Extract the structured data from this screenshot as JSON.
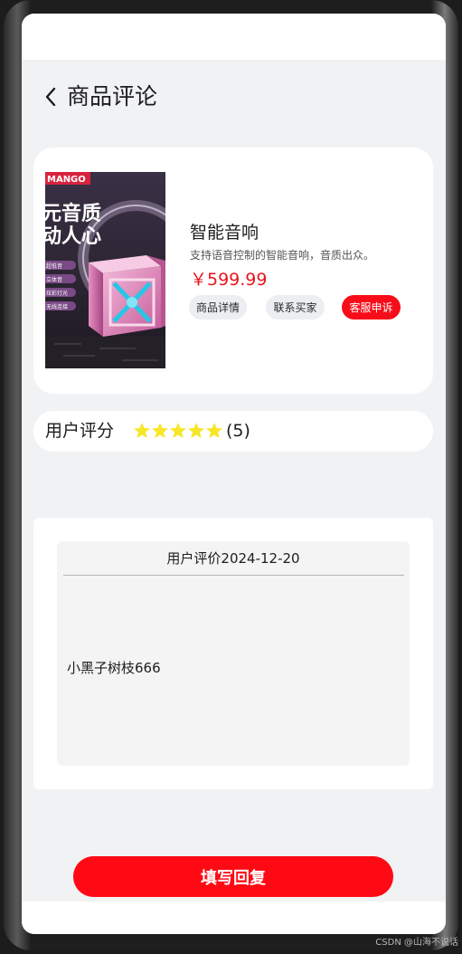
{
  "header": {
    "title": "商品评论",
    "back_icon": "chevron-left-icon"
  },
  "product": {
    "name": "智能音响",
    "description": "支持语音控制的智能音响，音质出众。",
    "price": "￥599.99",
    "image": {
      "brand_text": "MANGO",
      "headline_1": "元音质",
      "headline_2": "动人心",
      "tags": [
        "超低音",
        "立体音",
        "炫彩灯光",
        "无线连接"
      ]
    },
    "actions": {
      "detail_label": "商品详情",
      "contact_label": "联系买家",
      "complaint_label": "客服申诉"
    }
  },
  "rating": {
    "label": "用户评分",
    "stars": 5,
    "max_stars": 5,
    "count_text": "(5)",
    "star_color": "#f7e62a"
  },
  "review": {
    "header": "用户评价2024-12-20",
    "content": "小黑子树枝666"
  },
  "reply_button": {
    "label": "填写回复",
    "color": "#ff0a14"
  },
  "watermark": "CSDN @山海不说话",
  "colors": {
    "accent_red": "#f70d19",
    "price_red": "#e8141e",
    "page_bg": "#f1f2f4"
  }
}
